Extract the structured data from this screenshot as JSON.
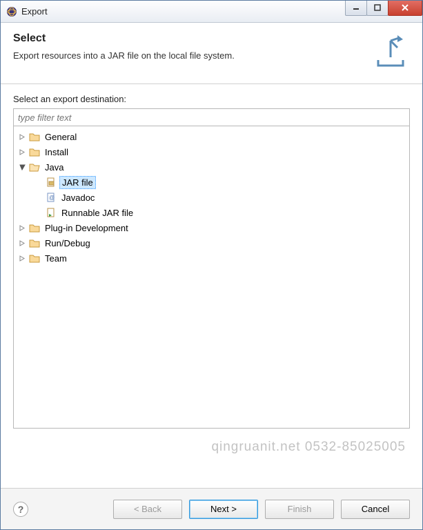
{
  "window": {
    "title": "Export"
  },
  "banner": {
    "title": "Select",
    "desc": "Export resources into a JAR file on the local file system."
  },
  "filter": {
    "label": "Select an export destination:",
    "placeholder": "type filter text"
  },
  "tree": {
    "general": "General",
    "install": "Install",
    "java": "Java",
    "java_children": {
      "jar": "JAR file",
      "javadoc": "Javadoc",
      "runnable": "Runnable JAR file"
    },
    "plugin": "Plug-in Development",
    "rundebug": "Run/Debug",
    "team": "Team"
  },
  "watermark": "qingruanit.net 0532-85025005",
  "buttons": {
    "back": "< Back",
    "next": "Next >",
    "finish": "Finish",
    "cancel": "Cancel"
  }
}
